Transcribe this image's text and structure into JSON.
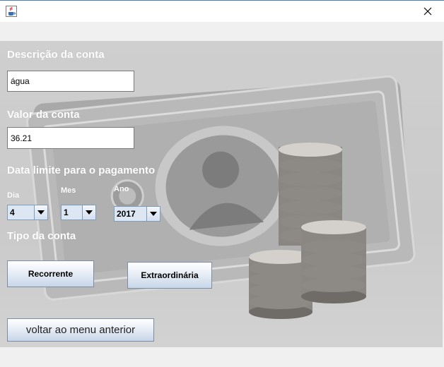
{
  "window": {
    "icons": {
      "app": "java-coffee-icon",
      "close": "close-icon"
    }
  },
  "form": {
    "descricao_label": "Descrição da conta",
    "descricao_value": "água",
    "valor_label": "Valor da conta",
    "valor_value": "36.21",
    "data_label": "Data limite para o pagamento",
    "dia_label": "Dia",
    "mes_label": "Mes",
    "ano_label": "Ano",
    "dia_value": "4",
    "mes_value": "1",
    "ano_value": "2017",
    "tipo_label": "Tipo da conta",
    "recorrente_label": "Recorrente",
    "extraordinaria_label": "Extraordinária",
    "voltar_label": "voltar ao menu anterior"
  },
  "background": {
    "image": "money-bill-and-coins"
  },
  "colors": {
    "panel": "#cccccc",
    "label_text": "#ffffff",
    "button_gradient_end": "#c8d6e8"
  }
}
